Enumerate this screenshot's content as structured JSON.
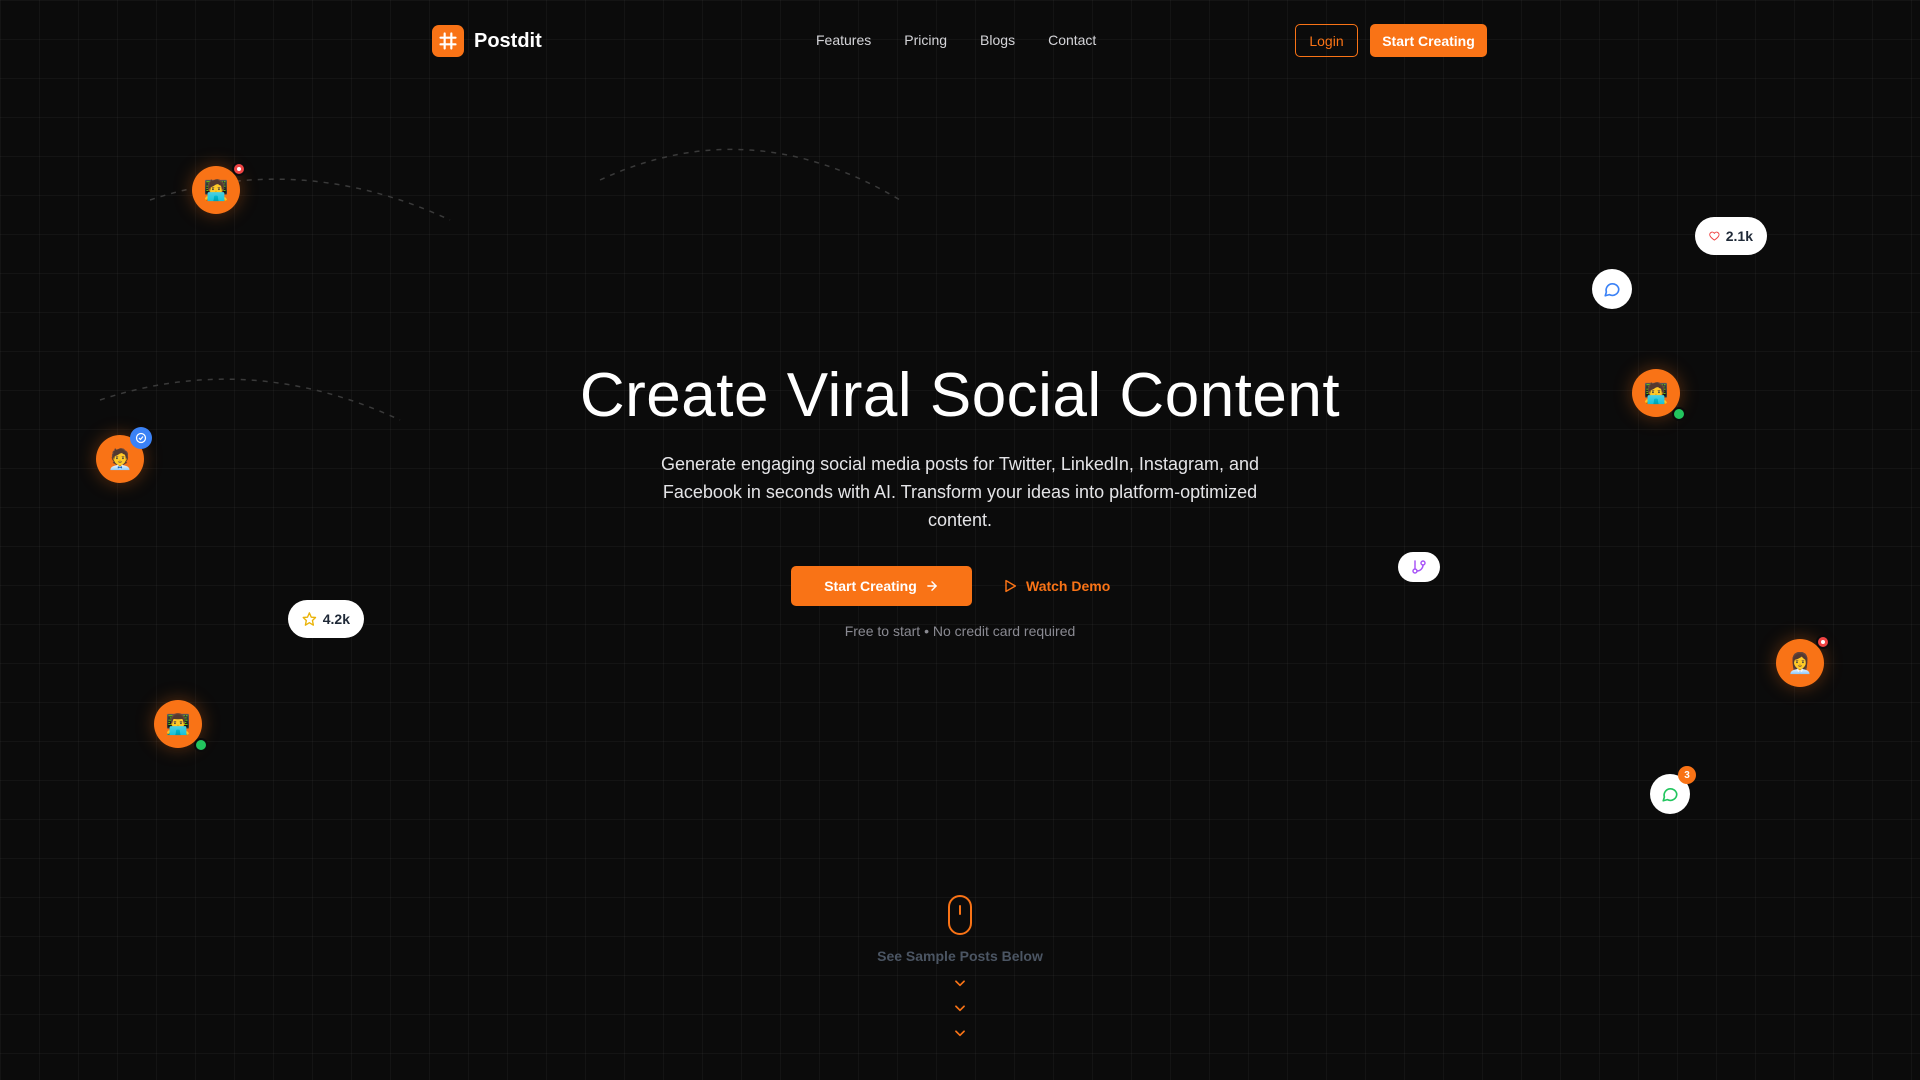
{
  "nav": {
    "brand": "Postdit",
    "links": [
      "Features",
      "Pricing",
      "Blogs",
      "Contact"
    ],
    "login_label": "Login",
    "start_label": "Start Creating"
  },
  "hero": {
    "title": "Create Viral Social Content",
    "subtitle": "Generate engaging social media posts for Twitter, LinkedIn, Instagram, and Facebook in seconds with AI. Transform your ideas into platform-optimized content.",
    "cta_primary": "Start Creating",
    "cta_secondary": "Watch Demo",
    "note": "Free to start • No credit card required"
  },
  "floaters": {
    "likes_count": "2.1k",
    "stars_count": "4.2k",
    "message_badge": "3",
    "avatars": {
      "top_left": "🧑‍💻",
      "mid_left": "🧑‍💼",
      "bottom_left": "👨‍💻",
      "right_upper": "🧑‍💻",
      "right_lower": "👩‍💼"
    }
  },
  "scroll": {
    "label": "See Sample Posts Below"
  },
  "colors": {
    "accent": "#f97316",
    "background": "#0b0b0b"
  },
  "icons": [
    "hash-logo-icon",
    "arrow-right-icon",
    "play-icon",
    "heart-icon",
    "chat-bubble-icon",
    "star-icon",
    "git-branch-icon",
    "whatsapp-icon",
    "verified-icon",
    "mouse-icon",
    "chevron-down-icon"
  ]
}
